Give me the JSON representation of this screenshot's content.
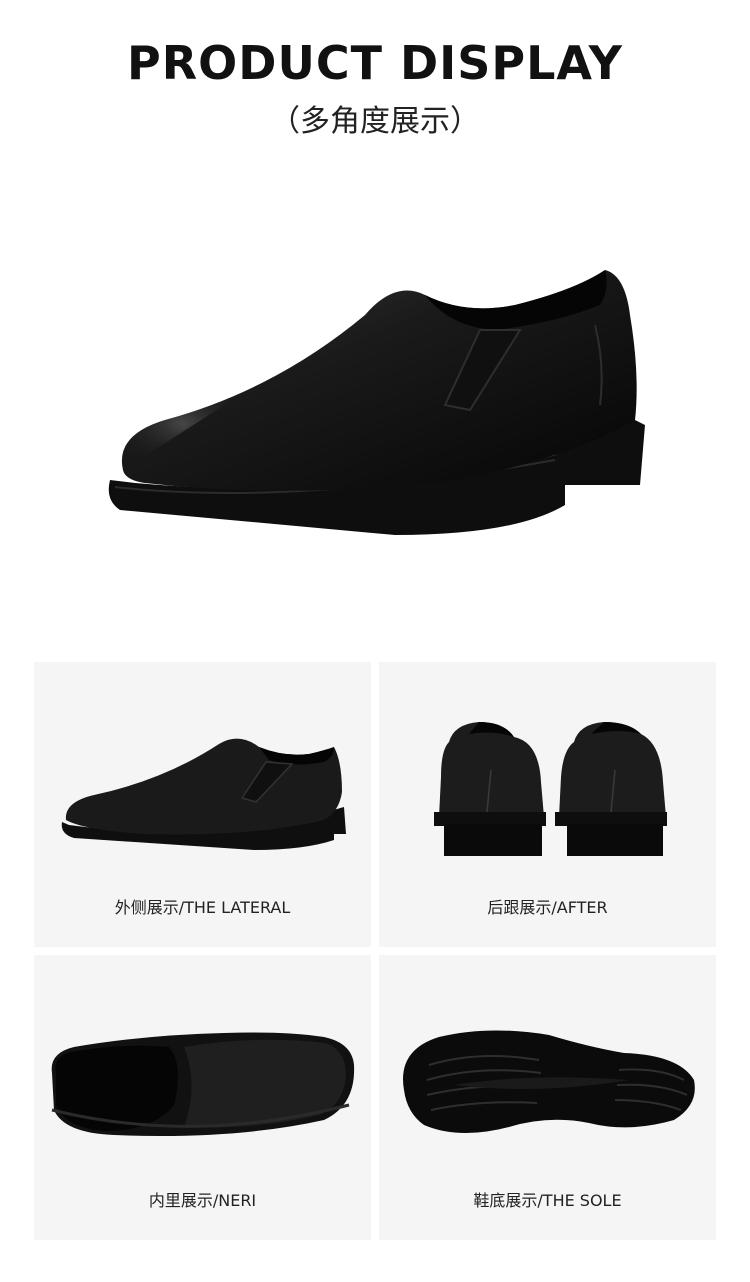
{
  "header": {
    "title": "PRODUCT DISPLAY",
    "subtitle": "（多角度展示）"
  },
  "views": [
    {
      "caption": "外侧展示/THE LATERAL",
      "icon": "shoe-side-icon"
    },
    {
      "caption": "后跟展示/AFTER",
      "icon": "shoe-heel-icon"
    },
    {
      "caption": "内里展示/NERI",
      "icon": "shoe-inner-icon"
    },
    {
      "caption": "鞋底展示/THE SOLE",
      "icon": "shoe-sole-icon"
    }
  ],
  "colors": {
    "background": "#ffffff",
    "card": "#f5f5f5",
    "leather": "#141414"
  }
}
